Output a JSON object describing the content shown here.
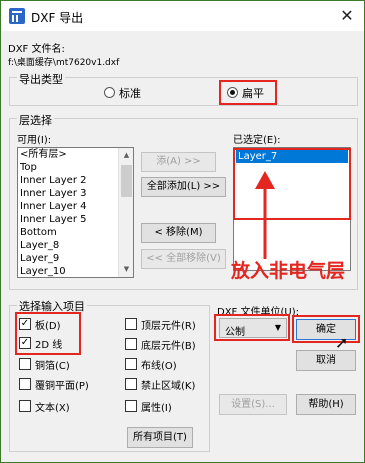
{
  "window": {
    "title": "DXF 导出",
    "close_glyph": "✕"
  },
  "file": {
    "label": "DXF 文件名:",
    "path": "f:\\桌面缓存\\mt7620v1.dxf"
  },
  "export_type": {
    "label": "导出类型",
    "options": [
      {
        "label": "标准",
        "selected": false
      },
      {
        "label": "扁平",
        "selected": true
      }
    ]
  },
  "layers": {
    "group_label": "层选择",
    "available_label": "可用(I):",
    "available": [
      "<所有层>",
      "Top",
      "Inner Layer 2",
      "Inner Layer 3",
      "Inner Layer 4",
      "Inner Layer 5",
      "Bottom",
      "Layer_8",
      "Layer_9",
      "Layer_10"
    ],
    "selected_label": "已选定(E):",
    "selected": [
      "Layer_7"
    ],
    "buttons": {
      "add": "添(A) >>",
      "add_all": "全部添加(L) >>",
      "remove": "< 移除(M)",
      "remove_all": "<< 全部移除(V)"
    }
  },
  "items": {
    "group_label": "选择输入项目",
    "checkboxes": [
      {
        "label": "板(D)",
        "checked": true
      },
      {
        "label": "2D 线",
        "checked": true
      },
      {
        "label": "铜箔(C)",
        "checked": false
      },
      {
        "label": "覆铜平面(P)",
        "checked": false
      },
      {
        "label": "文本(X)",
        "checked": false
      },
      {
        "label": "顶层元件(R)",
        "checked": false
      },
      {
        "label": "底层元件(B)",
        "checked": false
      },
      {
        "label": "布线(O)",
        "checked": false
      },
      {
        "label": "禁止区域(K)",
        "checked": false
      },
      {
        "label": "属性(I)",
        "checked": false
      }
    ],
    "all_button": "所有项目(T)"
  },
  "units": {
    "label": "DXF 文件单位(U):",
    "value": "公制"
  },
  "buttons": {
    "ok": "确定",
    "cancel": "取消",
    "settings": "设置(S)...",
    "help": "帮助(H)"
  },
  "annotation": {
    "text": "放入非电气层",
    "color": "#e3261f"
  }
}
